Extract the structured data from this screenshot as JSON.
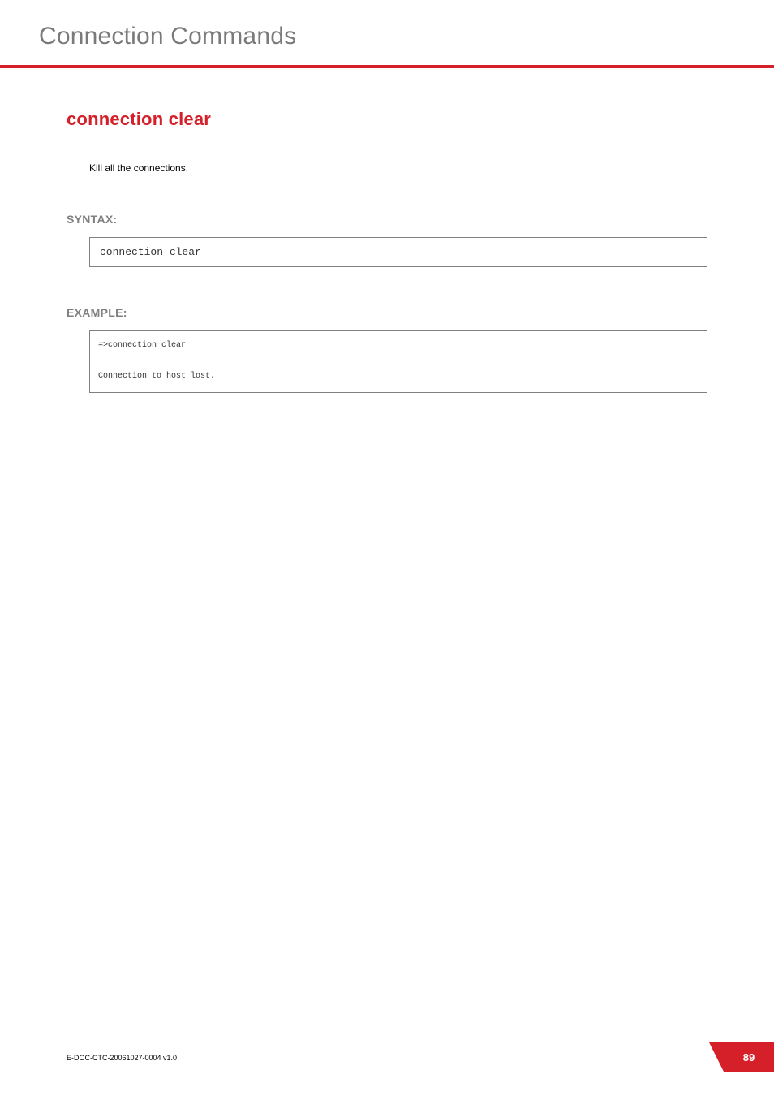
{
  "header": {
    "title": "Connection Commands"
  },
  "command": {
    "title": "connection clear",
    "description": "Kill all the connections."
  },
  "syntax": {
    "label": "SYNTAX:",
    "code": "connection clear"
  },
  "example": {
    "label": "EXAMPLE:",
    "code": "=>connection clear\n\nConnection to host lost."
  },
  "footer": {
    "doc_id": "E-DOC-CTC-20061027-0004 v1.0",
    "page_number": "89"
  }
}
